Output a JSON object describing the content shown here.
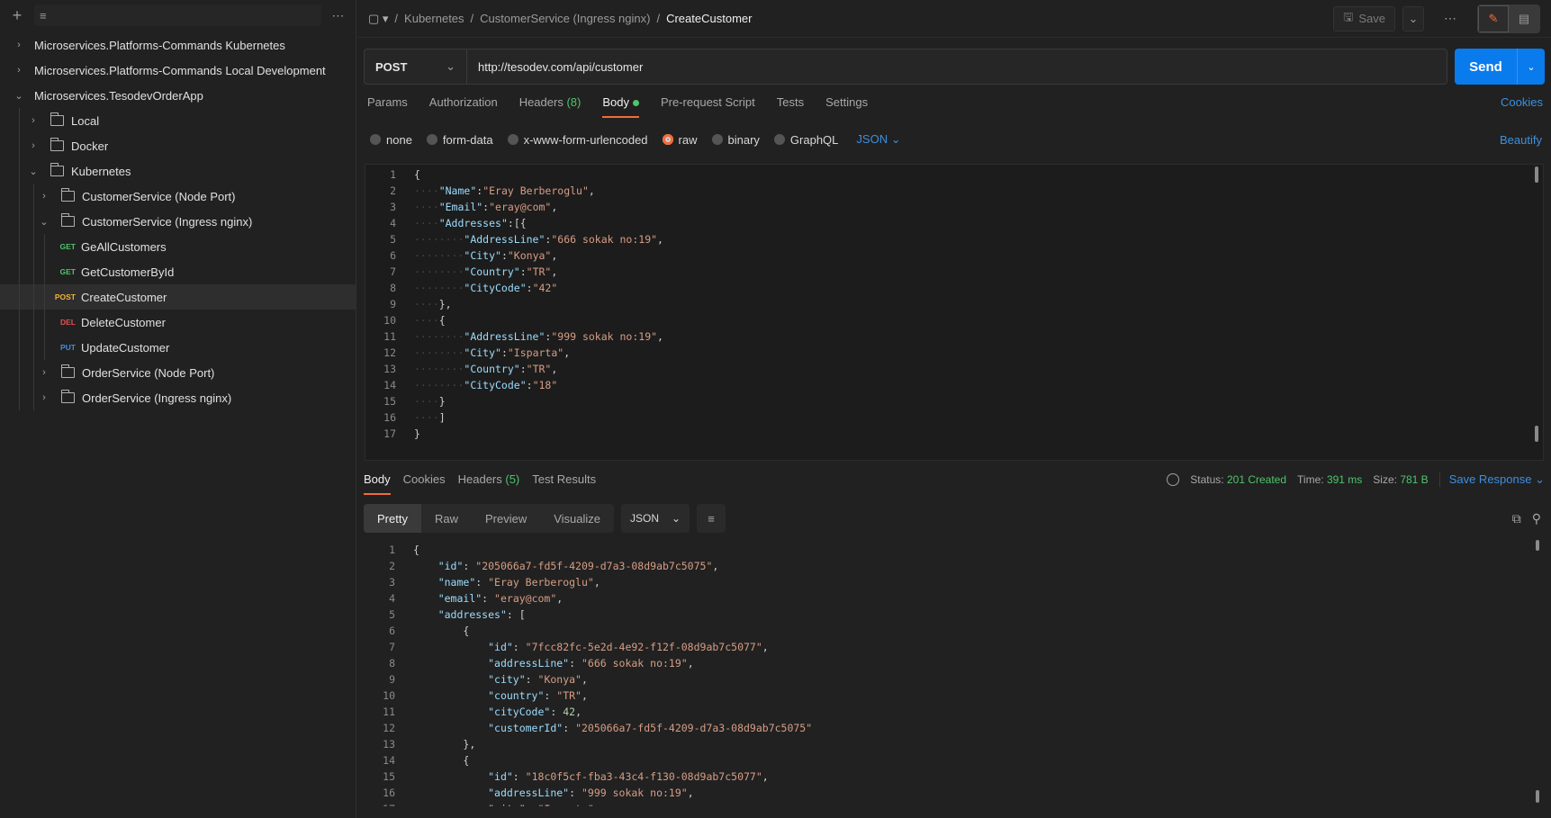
{
  "sidebar": {
    "more": "⋯",
    "tree": [
      {
        "label": "Microservices.Platforms-Commands Kubernetes",
        "chev": "›",
        "depth": 0,
        "type": "collection"
      },
      {
        "label": "Microservices.Platforms-Commands Local Development",
        "chev": "›",
        "depth": 0,
        "type": "collection"
      },
      {
        "label": "Microservices.TesodevOrderApp",
        "chev": "⌄",
        "depth": 0,
        "type": "collection"
      },
      {
        "label": "Local",
        "chev": "›",
        "depth": 1,
        "type": "folder"
      },
      {
        "label": "Docker",
        "chev": "›",
        "depth": 1,
        "type": "folder"
      },
      {
        "label": "Kubernetes",
        "chev": "⌄",
        "depth": 1,
        "type": "folder"
      },
      {
        "label": "CustomerService (Node Port)",
        "chev": "›",
        "depth": 2,
        "type": "folder"
      },
      {
        "label": "CustomerService (Ingress nginx)",
        "chev": "⌄",
        "depth": 2,
        "type": "folder"
      },
      {
        "label": "GeAllCustomers",
        "method": "GET",
        "depth": 3,
        "type": "request"
      },
      {
        "label": "GetCustomerById",
        "method": "GET",
        "depth": 3,
        "type": "request"
      },
      {
        "label": "CreateCustomer",
        "method": "POST",
        "depth": 3,
        "type": "request",
        "selected": true
      },
      {
        "label": "DeleteCustomer",
        "method": "DEL",
        "depth": 3,
        "type": "request"
      },
      {
        "label": "UpdateCustomer",
        "method": "PUT",
        "depth": 3,
        "type": "request"
      },
      {
        "label": "OrderService (Node Port)",
        "chev": "›",
        "depth": 2,
        "type": "folder"
      },
      {
        "label": "OrderService (Ingress nginx)",
        "chev": "›",
        "depth": 2,
        "type": "folder"
      }
    ]
  },
  "topbar": {
    "breadcrumb": [
      "Kubernetes",
      "CustomerService (Ingress nginx)",
      "CreateCustomer"
    ],
    "sep": "/",
    "save_label": "Save",
    "more": "⋯"
  },
  "request": {
    "method": "POST",
    "url": "http://tesodev.com/api/customer",
    "send_label": "Send",
    "tabs": {
      "params": "Params",
      "authorization": "Authorization",
      "headers": "Headers",
      "headers_count": "(8)",
      "body": "Body",
      "pre_request": "Pre-request Script",
      "tests": "Tests",
      "settings": "Settings"
    },
    "cookies": "Cookies",
    "body_types": [
      "none",
      "form-data",
      "x-www-form-urlencoded",
      "raw",
      "binary",
      "GraphQL"
    ],
    "selected_body_type": "raw",
    "language": "JSON",
    "beautify": "Beautify",
    "body_lines": [
      {
        "n": "1",
        "t": "{"
      },
      {
        "n": "2",
        "t": "    \"Name\":\"Eray Berberoglu\","
      },
      {
        "n": "3",
        "t": "    \"Email\":\"eray@com\","
      },
      {
        "n": "4",
        "t": "    \"Addresses\":[{"
      },
      {
        "n": "5",
        "t": "        \"AddressLine\":\"666 sokak no:19\","
      },
      {
        "n": "6",
        "t": "        \"City\":\"Konya\","
      },
      {
        "n": "7",
        "t": "        \"Country\":\"TR\","
      },
      {
        "n": "8",
        "t": "        \"CityCode\":\"42\""
      },
      {
        "n": "9",
        "t": "    },"
      },
      {
        "n": "10",
        "t": "    {"
      },
      {
        "n": "11",
        "t": "        \"AddressLine\":\"999 sokak no:19\","
      },
      {
        "n": "12",
        "t": "        \"City\":\"Isparta\","
      },
      {
        "n": "13",
        "t": "        \"Country\":\"TR\","
      },
      {
        "n": "14",
        "t": "        \"CityCode\":\"18\""
      },
      {
        "n": "15",
        "t": "    }"
      },
      {
        "n": "16",
        "t": "    ]"
      },
      {
        "n": "17",
        "t": "}"
      }
    ]
  },
  "response": {
    "tabs": {
      "body": "Body",
      "cookies": "Cookies",
      "headers": "Headers",
      "headers_count": "(5)",
      "test_results": "Test Results"
    },
    "status_label": "Status:",
    "status_value": "201 Created",
    "time_label": "Time:",
    "time_value": "391 ms",
    "size_label": "Size:",
    "size_value": "781 B",
    "save_response": "Save Response",
    "views": [
      "Pretty",
      "Raw",
      "Preview",
      "Visualize"
    ],
    "active_view": "Pretty",
    "language": "JSON",
    "lines": [
      {
        "n": "1",
        "t": "{"
      },
      {
        "n": "2",
        "t": "    \"id\": \"205066a7-fd5f-4209-d7a3-08d9ab7c5075\","
      },
      {
        "n": "3",
        "t": "    \"name\": \"Eray Berberoglu\","
      },
      {
        "n": "4",
        "t": "    \"email\": \"eray@com\","
      },
      {
        "n": "5",
        "t": "    \"addresses\": ["
      },
      {
        "n": "6",
        "t": "        {"
      },
      {
        "n": "7",
        "t": "            \"id\": \"7fcc82fc-5e2d-4e92-f12f-08d9ab7c5077\","
      },
      {
        "n": "8",
        "t": "            \"addressLine\": \"666 sokak no:19\","
      },
      {
        "n": "9",
        "t": "            \"city\": \"Konya\","
      },
      {
        "n": "10",
        "t": "            \"country\": \"TR\","
      },
      {
        "n": "11",
        "t": "            \"cityCode\": 42,"
      },
      {
        "n": "12",
        "t": "            \"customerId\": \"205066a7-fd5f-4209-d7a3-08d9ab7c5075\""
      },
      {
        "n": "13",
        "t": "        },"
      },
      {
        "n": "14",
        "t": "        {"
      },
      {
        "n": "15",
        "t": "            \"id\": \"18c0f5cf-fba3-43c4-f130-08d9ab7c5077\","
      },
      {
        "n": "16",
        "t": "            \"addressLine\": \"999 sokak no:19\","
      },
      {
        "n": "17",
        "t": "            \"city\": \"Isparta\","
      }
    ]
  },
  "colors": {
    "accent": "#f26b3a",
    "send": "#097bed",
    "link": "#3d8fe0",
    "success": "#4ec46b"
  }
}
